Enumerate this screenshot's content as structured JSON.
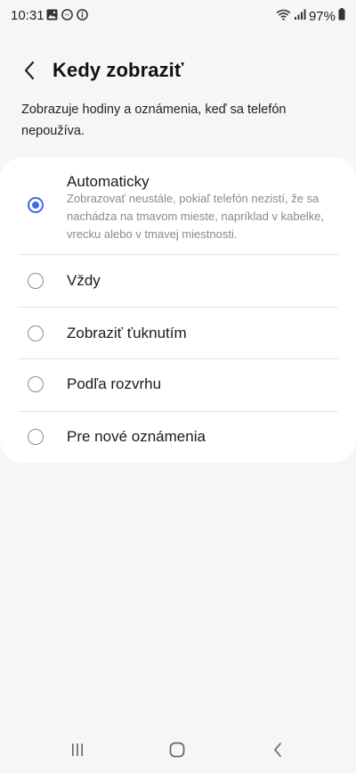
{
  "status_bar": {
    "time": "10:31",
    "battery": "97%",
    "left_icons": [
      "image-icon",
      "messenger-icon",
      "info-icon"
    ],
    "right_icons": [
      "wifi-icon",
      "signal-icon",
      "battery-icon"
    ]
  },
  "header": {
    "title": "Kedy zobraziť",
    "back_icon": "chevron-left-icon"
  },
  "description": "Zobrazuje hodiny a oznámenia, keď sa telefón nepoužíva.",
  "options": [
    {
      "label": "Automaticky",
      "description": "Zobrazovať neustále, pokiaľ telefón nezistí, že sa nachádza na tmavom mieste, napríklad v kabelke, vrecku alebo v tmavej miestnosti.",
      "selected": true
    },
    {
      "label": "Vždy",
      "selected": false
    },
    {
      "label": "Zobraziť ťuknutím",
      "selected": false
    },
    {
      "label": "Podľa rozvrhu",
      "selected": false
    },
    {
      "label": "Pre nové oznámenia",
      "selected": false
    }
  ],
  "navigation": {
    "recents_icon": "recents-icon",
    "home_icon": "home-icon",
    "back_icon": "back-icon"
  },
  "colors": {
    "accent": "#3e6ce0",
    "background": "#f6f6f8",
    "card": "#ffffff"
  }
}
